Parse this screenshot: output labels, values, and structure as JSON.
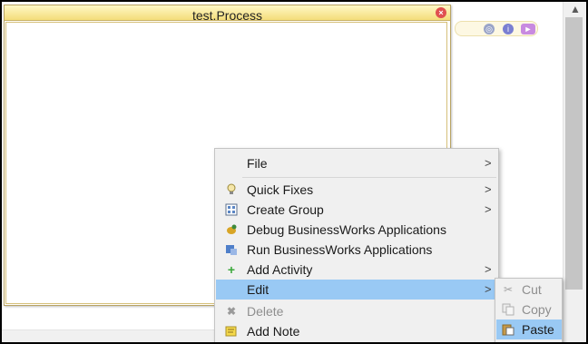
{
  "process": {
    "title": "test.Process"
  },
  "context_menu": {
    "items": [
      {
        "label": "File",
        "has_submenu": true,
        "enabled": true,
        "icon": ""
      },
      {
        "label": "Quick Fixes",
        "has_submenu": true,
        "enabled": true,
        "icon": "lightbulb-icon"
      },
      {
        "label": "Create Group",
        "has_submenu": true,
        "enabled": true,
        "icon": "group-icon"
      },
      {
        "label": "Debug BusinessWorks Applications",
        "has_submenu": false,
        "enabled": true,
        "icon": "debug-icon"
      },
      {
        "label": "Run BusinessWorks Applications",
        "has_submenu": false,
        "enabled": true,
        "icon": "run-icon"
      },
      {
        "label": "Add Activity",
        "has_submenu": true,
        "enabled": true,
        "icon": "plus-icon"
      },
      {
        "label": "Edit",
        "has_submenu": true,
        "enabled": true,
        "highlighted": true,
        "icon": ""
      },
      {
        "label": "Delete",
        "has_submenu": false,
        "enabled": false,
        "icon": "delete-icon"
      },
      {
        "label": "Add Note",
        "has_submenu": false,
        "enabled": true,
        "icon": "note-icon"
      }
    ],
    "submenu_arrow": ">"
  },
  "edit_submenu": {
    "items": [
      {
        "label": "Cut",
        "enabled": false,
        "icon": "scissors-icon"
      },
      {
        "label": "Copy",
        "enabled": false,
        "icon": "copy-icon"
      },
      {
        "label": "Paste",
        "enabled": true,
        "highlighted": true,
        "icon": "paste-icon"
      }
    ]
  },
  "colors": {
    "menu_highlight": "#99c9f4",
    "title_bar": "#f4dd7a",
    "menu_background": "#f0f0f0"
  }
}
